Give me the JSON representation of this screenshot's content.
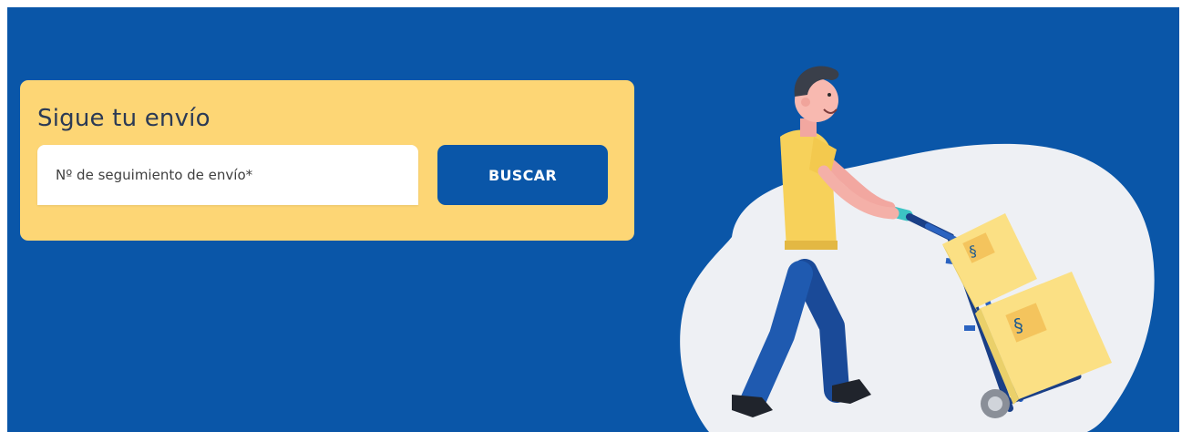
{
  "tracking": {
    "title": "Sigue tu envío",
    "input_placeholder": "Nº de seguimiento de envío*",
    "input_value": "",
    "search_button_label": "BUSCAR"
  },
  "illustration": {
    "name": "delivery-man-hand-truck-illustration"
  },
  "colors": {
    "background": "#0a56a8",
    "card": "#fdd675",
    "button": "#0a56a8",
    "button_text": "#ffffff",
    "title_text": "#2b3a55",
    "blob": "#eef0f4",
    "box": "#fbe084",
    "shirt": "#f7d15a",
    "pants": "#1f5ab0"
  }
}
